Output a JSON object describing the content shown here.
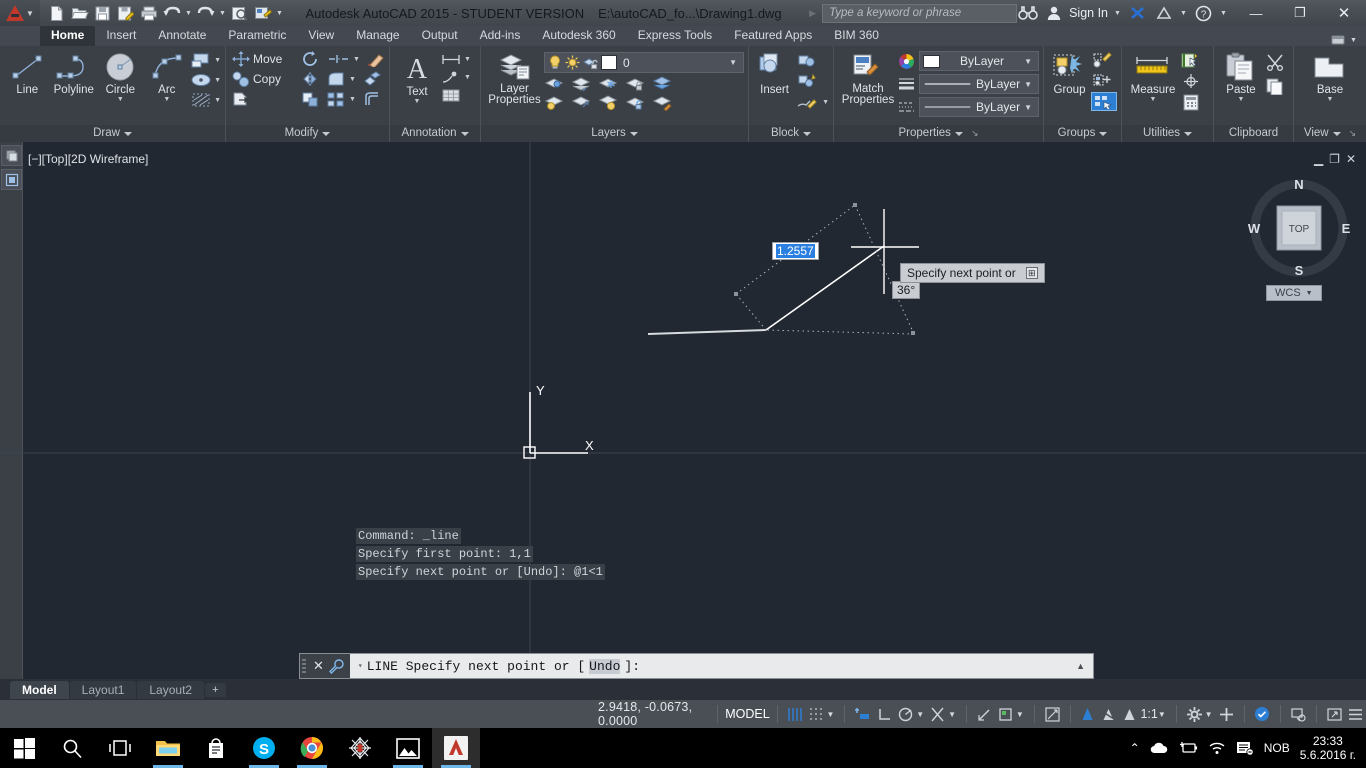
{
  "titlebar": {
    "app_title": "Autodesk AutoCAD 2015 - STUDENT VERSION",
    "file_path": "E:\\autoCAD_fo...\\Drawing1.dwg",
    "search_placeholder": "Type a keyword or phrase",
    "signin_label": "Sign In",
    "quick_access": [
      {
        "name": "new-file-icon",
        "label": "New"
      },
      {
        "name": "open-file-icon",
        "label": "Open"
      },
      {
        "name": "save-icon",
        "label": "Save"
      },
      {
        "name": "save-as-icon",
        "label": "Save As"
      },
      {
        "name": "plot-icon",
        "label": "Plot"
      },
      {
        "name": "undo-icon",
        "label": "Undo"
      },
      {
        "name": "redo-icon",
        "label": "Redo"
      },
      {
        "name": "plot-preview-icon",
        "label": "Plot Preview"
      },
      {
        "name": "workspace-icon",
        "label": "Workspace Switching"
      }
    ],
    "window_controls": {
      "minimize": "—",
      "maximize": "❐",
      "close": "✕"
    }
  },
  "ribbon_tabs": [
    {
      "label": "Home",
      "active": true
    },
    {
      "label": "Insert",
      "active": false
    },
    {
      "label": "Annotate",
      "active": false
    },
    {
      "label": "Parametric",
      "active": false
    },
    {
      "label": "View",
      "active": false
    },
    {
      "label": "Manage",
      "active": false
    },
    {
      "label": "Output",
      "active": false
    },
    {
      "label": "Add-ins",
      "active": false
    },
    {
      "label": "Autodesk 360",
      "active": false
    },
    {
      "label": "Express Tools",
      "active": false
    },
    {
      "label": "Featured Apps",
      "active": false
    },
    {
      "label": "BIM 360",
      "active": false
    }
  ],
  "ribbon_panels": {
    "draw": {
      "title": "Draw",
      "big_buttons": [
        {
          "label": "Line",
          "icon": "line-icon"
        },
        {
          "label": "Polyline",
          "icon": "polyline-icon"
        },
        {
          "label": "Circle",
          "icon": "circle-icon",
          "dropdown": true
        },
        {
          "label": "Arc",
          "icon": "arc-icon",
          "dropdown": true
        }
      ],
      "small_buttons": [
        {
          "icon": "rectangle-icon",
          "label": "Rectangle"
        },
        {
          "icon": "ellipse-icon",
          "label": "Ellipse"
        },
        {
          "icon": "hatch-icon",
          "label": "Hatch"
        }
      ]
    },
    "modify": {
      "title": "Modify",
      "items": [
        {
          "label": "Move",
          "icon": "move-icon"
        },
        {
          "label": "Copy",
          "icon": "copy-icon"
        },
        {
          "label": "",
          "icon": "stretch-icon"
        },
        {
          "label": "",
          "icon": "rotate-icon"
        },
        {
          "label": "",
          "icon": "mirror-icon"
        },
        {
          "label": "",
          "icon": "scale-icon"
        },
        {
          "label": "",
          "icon": "trim-icon"
        },
        {
          "label": "",
          "icon": "fillet-icon"
        },
        {
          "label": "",
          "icon": "array-icon"
        },
        {
          "label": "",
          "icon": "erase-icon"
        },
        {
          "label": "",
          "icon": "explode-icon"
        },
        {
          "label": "",
          "icon": "offset-icon"
        }
      ]
    },
    "annotation": {
      "title": "Annotation",
      "big_button": {
        "label": "Text",
        "icon": "text-icon",
        "dropdown": true
      },
      "small_buttons": [
        {
          "icon": "dimension-icon",
          "label": "Dimension"
        },
        {
          "icon": "leader-icon",
          "label": "Leader"
        },
        {
          "icon": "table-icon",
          "label": "Table"
        }
      ]
    },
    "layers": {
      "title": "Layers",
      "big_button": {
        "label": "Layer\nProperties",
        "label_line1": "Layer",
        "label_line2": "Properties",
        "icon": "layer-properties-icon"
      },
      "current_layer": "0",
      "layer_state_icons": [
        "lightbulb-icon",
        "sun-icon",
        "unlock-icon",
        "color-swatch-icon"
      ],
      "tool_icons": [
        "layer-isolate-icon",
        "layer-unisolate-icon",
        "layer-freeze-icon",
        "layer-lock-icon",
        "layer-make-current-icon",
        "layer-on-icon",
        "layer-off-icon",
        "layer-thaw-icon",
        "layer-unlock-icon",
        "layer-match-icon"
      ]
    },
    "block": {
      "title": "Block",
      "big_button": {
        "label": "Insert",
        "icon": "insert-block-icon"
      },
      "small_buttons": [
        {
          "icon": "create-block-icon",
          "label": "Create Block"
        },
        {
          "icon": "edit-attribute-icon",
          "label": "Edit Attribute"
        },
        {
          "icon": "define-attributes-icon",
          "label": "Define Attributes"
        }
      ]
    },
    "properties": {
      "title": "Properties",
      "big_button": {
        "label_line1": "Match",
        "label_line2": "Properties",
        "icon": "match-properties-icon"
      },
      "combos": [
        {
          "icon": "color-wheel-icon",
          "value": "ByLayer",
          "type": "color"
        },
        {
          "icon": "linewidth-icon",
          "value": "ByLayer",
          "type": "lineweight"
        },
        {
          "icon": "linetype-icon",
          "value": "ByLayer",
          "type": "linetype"
        }
      ]
    },
    "groups": {
      "title": "Groups",
      "big_button": {
        "label": "Group",
        "icon": "group-icon"
      },
      "small_buttons": [
        {
          "icon": "edit-group-icon",
          "label": "Edit Group"
        },
        {
          "icon": "add-to-group-icon",
          "label": "Add to Group"
        },
        {
          "icon": "group-selection-icon",
          "label": "Group Selection On/Off",
          "active": true
        }
      ]
    },
    "utilities": {
      "title": "Utilities",
      "big_button": {
        "label": "Measure",
        "icon": "measure-icon",
        "dropdown": true
      },
      "small_buttons": [
        {
          "icon": "quick-select-icon",
          "label": "Quick Select"
        },
        {
          "icon": "point-id-icon",
          "label": "ID Point"
        },
        {
          "icon": "calculator-icon",
          "label": "Quick Calculator"
        }
      ]
    },
    "clipboard": {
      "title": "Clipboard",
      "big_button": {
        "label": "Paste",
        "icon": "paste-icon",
        "dropdown": true
      },
      "small_buttons": [
        {
          "icon": "cut-icon",
          "label": "Cut"
        },
        {
          "icon": "copy-clip-icon",
          "label": "Copy"
        }
      ]
    },
    "view": {
      "title": "View",
      "big_button": {
        "label": "Base",
        "icon": "base-view-icon",
        "dropdown": true
      }
    }
  },
  "viewport": {
    "label": "[−][Top][2D Wireframe]",
    "ucs_x_label": "X",
    "ucs_y_label": "Y",
    "viewcube": {
      "north": "N",
      "south": "S",
      "east": "E",
      "west": "W",
      "face": "TOP",
      "ucs_label": "WCS"
    },
    "dynamic_input": {
      "distance_value": "1.2557",
      "angle_value": "36",
      "angle_suffix": "°"
    },
    "tooltip": {
      "text": "Specify next point or",
      "expand_icon": "expand-icon"
    }
  },
  "command_history": [
    "Command: _line",
    "Specify first point: 1,1",
    "Specify next point or [Undo]: @1<1"
  ],
  "command_input": {
    "prefix": "LINE Specify next point or [",
    "keyword": "Undo",
    "suffix": "]:",
    "close_icon": "close-icon",
    "customize_icon": "wrench-icon",
    "expand_icon": "chevron-up-icon"
  },
  "layout_tabs": [
    {
      "label": "Model",
      "active": true
    },
    {
      "label": "Layout1",
      "active": false
    },
    {
      "label": "Layout2",
      "active": false
    },
    {
      "label": "+",
      "active": false
    }
  ],
  "statusbar": {
    "coordinates": "2.9418, -0.0673, 0.0000",
    "space_label": "MODEL",
    "scale": "1:1",
    "toggles": [
      {
        "name": "grid-display-icon",
        "active": true
      },
      {
        "name": "snap-mode-icon",
        "active": false
      },
      {
        "name": "infer-constraints-icon",
        "active": false
      },
      {
        "name": "ortho-mode-icon",
        "active": false
      },
      {
        "name": "polar-tracking-icon",
        "active": false
      },
      {
        "name": "object-snap-icon",
        "active": false
      },
      {
        "name": "object-snap-tracking-icon",
        "active": false
      },
      {
        "name": "lineweight-display-icon",
        "active": false
      },
      {
        "name": "transparency-icon",
        "active": false
      },
      {
        "name": "selection-cycling-icon",
        "active": false
      },
      {
        "name": "dynamic-ucs-icon",
        "active": false
      },
      {
        "name": "annotation-visibility-icon",
        "active": true
      },
      {
        "name": "autoscale-icon",
        "active": true
      },
      {
        "name": "annotation-scale-icon",
        "active": true
      },
      {
        "name": "workspace-switching-icon",
        "active": false
      },
      {
        "name": "hardware-acceleration-icon",
        "active": false
      },
      {
        "name": "isolate-objects-icon",
        "active": true
      },
      {
        "name": "clean-screen-icon",
        "active": false
      },
      {
        "name": "customization-menu-icon",
        "active": false
      }
    ]
  },
  "taskbar": {
    "items": [
      {
        "name": "start-button",
        "label": "Start"
      },
      {
        "name": "search-icon",
        "label": "Search"
      },
      {
        "name": "task-view-icon",
        "label": "Task View"
      },
      {
        "name": "file-explorer-icon",
        "label": "File Explorer",
        "running": true
      },
      {
        "name": "microsoft-store-icon",
        "label": "Store"
      },
      {
        "name": "skype-icon",
        "label": "Skype",
        "running": true
      },
      {
        "name": "chrome-icon",
        "label": "Google Chrome",
        "running": true
      },
      {
        "name": "spider-app-icon",
        "label": "Spider App"
      },
      {
        "name": "photos-icon",
        "label": "Photos",
        "running": true
      },
      {
        "name": "autocad-icon",
        "label": "AutoCAD",
        "running": true,
        "active": true
      }
    ],
    "tray": {
      "overflow_icon": "chevron-up-icon",
      "onedrive_icon": "onedrive-icon",
      "battery_icon": "battery-icon",
      "wifi_icon": "wifi-icon",
      "action-center_icon": "action-center-icon",
      "language": "NOB",
      "time": "23:33",
      "date": "5.6.2016 г."
    }
  },
  "colors": {
    "canvas_bg": "#222831",
    "ribbon_bg": "#3b4046",
    "accent_blue": "#2a7fe0",
    "status_active": "#2d7fd3"
  }
}
